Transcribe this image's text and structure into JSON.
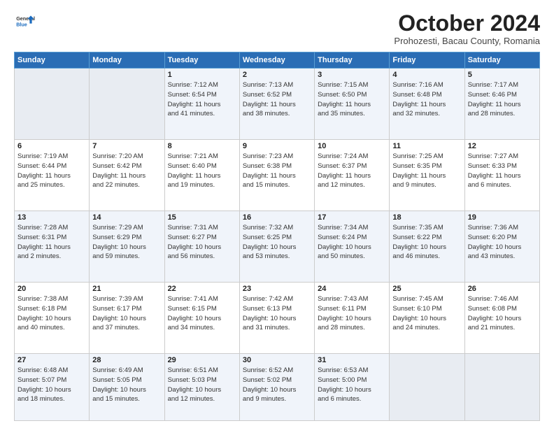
{
  "header": {
    "logo": {
      "general": "General",
      "blue": "Blue"
    },
    "title": "October 2024",
    "subtitle": "Prohozesti, Bacau County, Romania"
  },
  "weekdays": [
    "Sunday",
    "Monday",
    "Tuesday",
    "Wednesday",
    "Thursday",
    "Friday",
    "Saturday"
  ],
  "weeks": [
    [
      {
        "day": "",
        "empty": true
      },
      {
        "day": "",
        "empty": true
      },
      {
        "day": "1",
        "lines": [
          "Sunrise: 7:12 AM",
          "Sunset: 6:54 PM",
          "Daylight: 11 hours",
          "and 41 minutes."
        ]
      },
      {
        "day": "2",
        "lines": [
          "Sunrise: 7:13 AM",
          "Sunset: 6:52 PM",
          "Daylight: 11 hours",
          "and 38 minutes."
        ]
      },
      {
        "day": "3",
        "lines": [
          "Sunrise: 7:15 AM",
          "Sunset: 6:50 PM",
          "Daylight: 11 hours",
          "and 35 minutes."
        ]
      },
      {
        "day": "4",
        "lines": [
          "Sunrise: 7:16 AM",
          "Sunset: 6:48 PM",
          "Daylight: 11 hours",
          "and 32 minutes."
        ]
      },
      {
        "day": "5",
        "lines": [
          "Sunrise: 7:17 AM",
          "Sunset: 6:46 PM",
          "Daylight: 11 hours",
          "and 28 minutes."
        ]
      }
    ],
    [
      {
        "day": "6",
        "lines": [
          "Sunrise: 7:19 AM",
          "Sunset: 6:44 PM",
          "Daylight: 11 hours",
          "and 25 minutes."
        ]
      },
      {
        "day": "7",
        "lines": [
          "Sunrise: 7:20 AM",
          "Sunset: 6:42 PM",
          "Daylight: 11 hours",
          "and 22 minutes."
        ]
      },
      {
        "day": "8",
        "lines": [
          "Sunrise: 7:21 AM",
          "Sunset: 6:40 PM",
          "Daylight: 11 hours",
          "and 19 minutes."
        ]
      },
      {
        "day": "9",
        "lines": [
          "Sunrise: 7:23 AM",
          "Sunset: 6:38 PM",
          "Daylight: 11 hours",
          "and 15 minutes."
        ]
      },
      {
        "day": "10",
        "lines": [
          "Sunrise: 7:24 AM",
          "Sunset: 6:37 PM",
          "Daylight: 11 hours",
          "and 12 minutes."
        ]
      },
      {
        "day": "11",
        "lines": [
          "Sunrise: 7:25 AM",
          "Sunset: 6:35 PM",
          "Daylight: 11 hours",
          "and 9 minutes."
        ]
      },
      {
        "day": "12",
        "lines": [
          "Sunrise: 7:27 AM",
          "Sunset: 6:33 PM",
          "Daylight: 11 hours",
          "and 6 minutes."
        ]
      }
    ],
    [
      {
        "day": "13",
        "lines": [
          "Sunrise: 7:28 AM",
          "Sunset: 6:31 PM",
          "Daylight: 11 hours",
          "and 2 minutes."
        ]
      },
      {
        "day": "14",
        "lines": [
          "Sunrise: 7:29 AM",
          "Sunset: 6:29 PM",
          "Daylight: 10 hours",
          "and 59 minutes."
        ]
      },
      {
        "day": "15",
        "lines": [
          "Sunrise: 7:31 AM",
          "Sunset: 6:27 PM",
          "Daylight: 10 hours",
          "and 56 minutes."
        ]
      },
      {
        "day": "16",
        "lines": [
          "Sunrise: 7:32 AM",
          "Sunset: 6:25 PM",
          "Daylight: 10 hours",
          "and 53 minutes."
        ]
      },
      {
        "day": "17",
        "lines": [
          "Sunrise: 7:34 AM",
          "Sunset: 6:24 PM",
          "Daylight: 10 hours",
          "and 50 minutes."
        ]
      },
      {
        "day": "18",
        "lines": [
          "Sunrise: 7:35 AM",
          "Sunset: 6:22 PM",
          "Daylight: 10 hours",
          "and 46 minutes."
        ]
      },
      {
        "day": "19",
        "lines": [
          "Sunrise: 7:36 AM",
          "Sunset: 6:20 PM",
          "Daylight: 10 hours",
          "and 43 minutes."
        ]
      }
    ],
    [
      {
        "day": "20",
        "lines": [
          "Sunrise: 7:38 AM",
          "Sunset: 6:18 PM",
          "Daylight: 10 hours",
          "and 40 minutes."
        ]
      },
      {
        "day": "21",
        "lines": [
          "Sunrise: 7:39 AM",
          "Sunset: 6:17 PM",
          "Daylight: 10 hours",
          "and 37 minutes."
        ]
      },
      {
        "day": "22",
        "lines": [
          "Sunrise: 7:41 AM",
          "Sunset: 6:15 PM",
          "Daylight: 10 hours",
          "and 34 minutes."
        ]
      },
      {
        "day": "23",
        "lines": [
          "Sunrise: 7:42 AM",
          "Sunset: 6:13 PM",
          "Daylight: 10 hours",
          "and 31 minutes."
        ]
      },
      {
        "day": "24",
        "lines": [
          "Sunrise: 7:43 AM",
          "Sunset: 6:11 PM",
          "Daylight: 10 hours",
          "and 28 minutes."
        ]
      },
      {
        "day": "25",
        "lines": [
          "Sunrise: 7:45 AM",
          "Sunset: 6:10 PM",
          "Daylight: 10 hours",
          "and 24 minutes."
        ]
      },
      {
        "day": "26",
        "lines": [
          "Sunrise: 7:46 AM",
          "Sunset: 6:08 PM",
          "Daylight: 10 hours",
          "and 21 minutes."
        ]
      }
    ],
    [
      {
        "day": "27",
        "lines": [
          "Sunrise: 6:48 AM",
          "Sunset: 5:07 PM",
          "Daylight: 10 hours",
          "and 18 minutes."
        ]
      },
      {
        "day": "28",
        "lines": [
          "Sunrise: 6:49 AM",
          "Sunset: 5:05 PM",
          "Daylight: 10 hours",
          "and 15 minutes."
        ]
      },
      {
        "day": "29",
        "lines": [
          "Sunrise: 6:51 AM",
          "Sunset: 5:03 PM",
          "Daylight: 10 hours",
          "and 12 minutes."
        ]
      },
      {
        "day": "30",
        "lines": [
          "Sunrise: 6:52 AM",
          "Sunset: 5:02 PM",
          "Daylight: 10 hours",
          "and 9 minutes."
        ]
      },
      {
        "day": "31",
        "lines": [
          "Sunrise: 6:53 AM",
          "Sunset: 5:00 PM",
          "Daylight: 10 hours",
          "and 6 minutes."
        ]
      },
      {
        "day": "",
        "empty": true
      },
      {
        "day": "",
        "empty": true
      }
    ]
  ]
}
